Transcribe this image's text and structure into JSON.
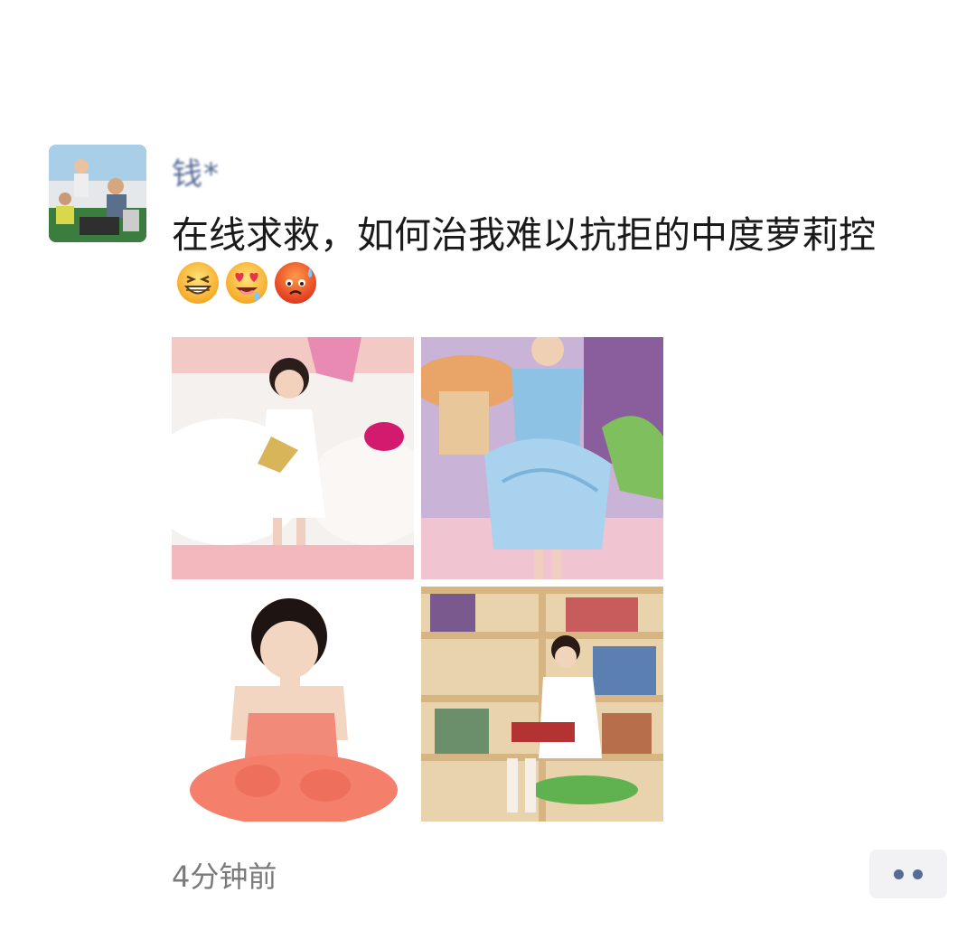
{
  "post": {
    "author_name": "钱*",
    "text": "在线求救，如何治我难以抗拒的中度萝莉控",
    "emojis": [
      "grinning-squint-emoji",
      "heart-eyes-drool-emoji",
      "sweat-frown-emoji"
    ],
    "photos": [
      {
        "name": "photo-girl-white-dress"
      },
      {
        "name": "photo-girl-blue-gown"
      },
      {
        "name": "photo-girl-pink-dress"
      },
      {
        "name": "photo-girl-reading-library"
      }
    ],
    "timestamp": "4分钟前",
    "more_icon": "more-dots-icon"
  },
  "colors": {
    "name_link": "#576b95",
    "body_text": "#1a1a1a",
    "timestamp": "#7a7a7a",
    "more_bg": "#f2f2f4"
  }
}
